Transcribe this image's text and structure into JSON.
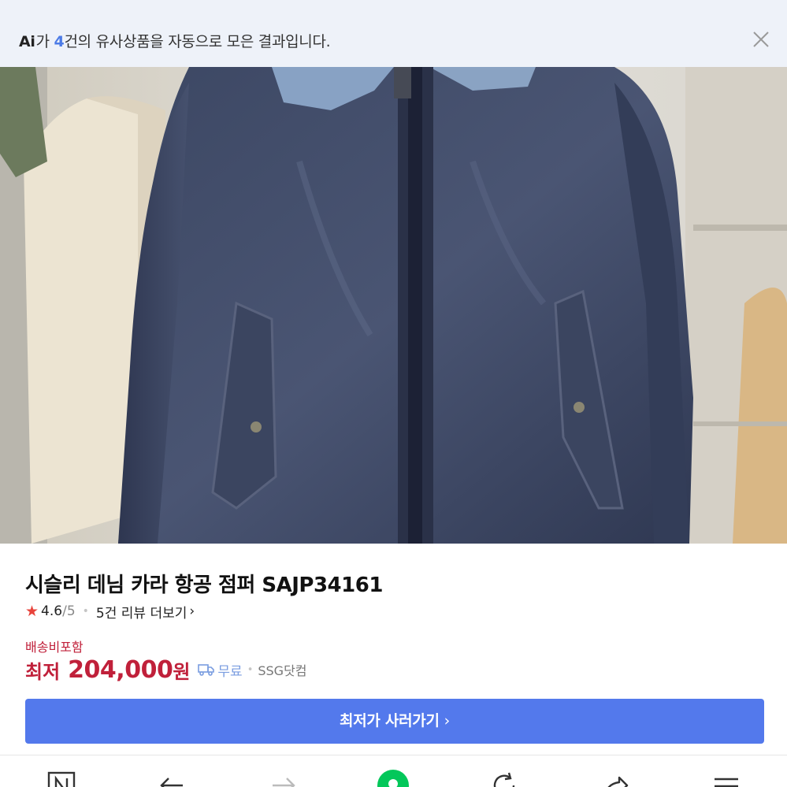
{
  "ai_banner": {
    "logo": "Ai",
    "prefix": "가 ",
    "count": "4",
    "suffix": "건의 유사상품을 자동으로 모은 결과입니다."
  },
  "icons": {
    "close": "close-icon",
    "expand": "expand-icon",
    "truck": "truck-icon",
    "star": "star-icon",
    "nav": [
      "naver-home-icon",
      "back-arrow-icon",
      "forward-arrow-icon",
      "green-home-icon",
      "refresh-icon",
      "share-icon",
      "menu-icon"
    ]
  },
  "carousel": {
    "total": 4,
    "active_index": 1
  },
  "product": {
    "title": "시슬리 데님 카라 항공 점퍼 SAJP34161",
    "rating": "4.6",
    "rating_max": "/5",
    "reviews_link": "5건 리뷰 더보기",
    "shipping_note": "배송비포함",
    "price_label": "최저",
    "price": "204,000",
    "price_unit": "원",
    "shipping_fee": "무료",
    "seller": "SSG닷컴"
  },
  "buy_button": {
    "label": "최저가 사러가기"
  },
  "colors": {
    "accent": "#5379ec",
    "price": "#c0203a",
    "banner_bg": "#eef2f9",
    "rating_star": "#e8433b",
    "nav_green": "#03c75a"
  }
}
